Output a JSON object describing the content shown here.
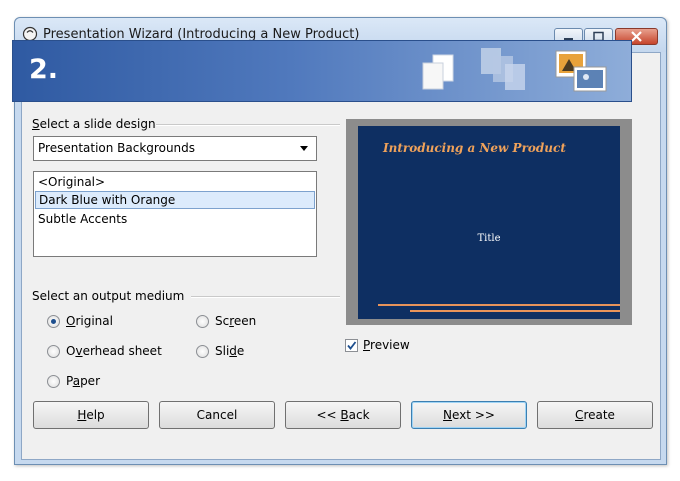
{
  "window": {
    "title": "Presentation Wizard (Introducing a New Product)",
    "step": "2."
  },
  "design": {
    "group_label_prefix": "",
    "group_label_mnemonic": "S",
    "group_label_rest": "elect a slide design",
    "category": "Presentation Backgrounds",
    "items": [
      "<Original>",
      "Dark Blue with Orange",
      "Subtle Accents"
    ],
    "selected_index": 1
  },
  "output": {
    "group_label": "Select an output medium",
    "options": [
      {
        "pre": "",
        "mn": "O",
        "post": "riginal",
        "checked": true
      },
      {
        "pre": "O",
        "mn": "v",
        "post": "erhead sheet",
        "checked": false
      },
      {
        "pre": "P",
        "mn": "a",
        "post": "per",
        "checked": false
      },
      {
        "pre": "Sc",
        "mn": "r",
        "post": "een",
        "checked": false
      },
      {
        "pre": "Sli",
        "mn": "d",
        "post": "e",
        "checked": false
      }
    ]
  },
  "preview": {
    "slide_title": "Introducing a New Product",
    "slide_subtitle": "Title",
    "checkbox_pre": "",
    "checkbox_mn": "P",
    "checkbox_post": "review",
    "checked": true
  },
  "buttons": {
    "help": {
      "pre": "",
      "mn": "H",
      "post": "elp"
    },
    "cancel": "Cancel",
    "back": {
      "pre": "<< ",
      "mn": "B",
      "post": "ack"
    },
    "next": {
      "pre": "",
      "mn": "N",
      "post": "ext >>"
    },
    "create": {
      "pre": "",
      "mn": "C",
      "post": "reate"
    }
  },
  "colors": {
    "banner": "#2f5aa2",
    "slide_bg": "#0e2f62",
    "slide_accent": "#e7935a",
    "selection": "#dcebfc"
  }
}
